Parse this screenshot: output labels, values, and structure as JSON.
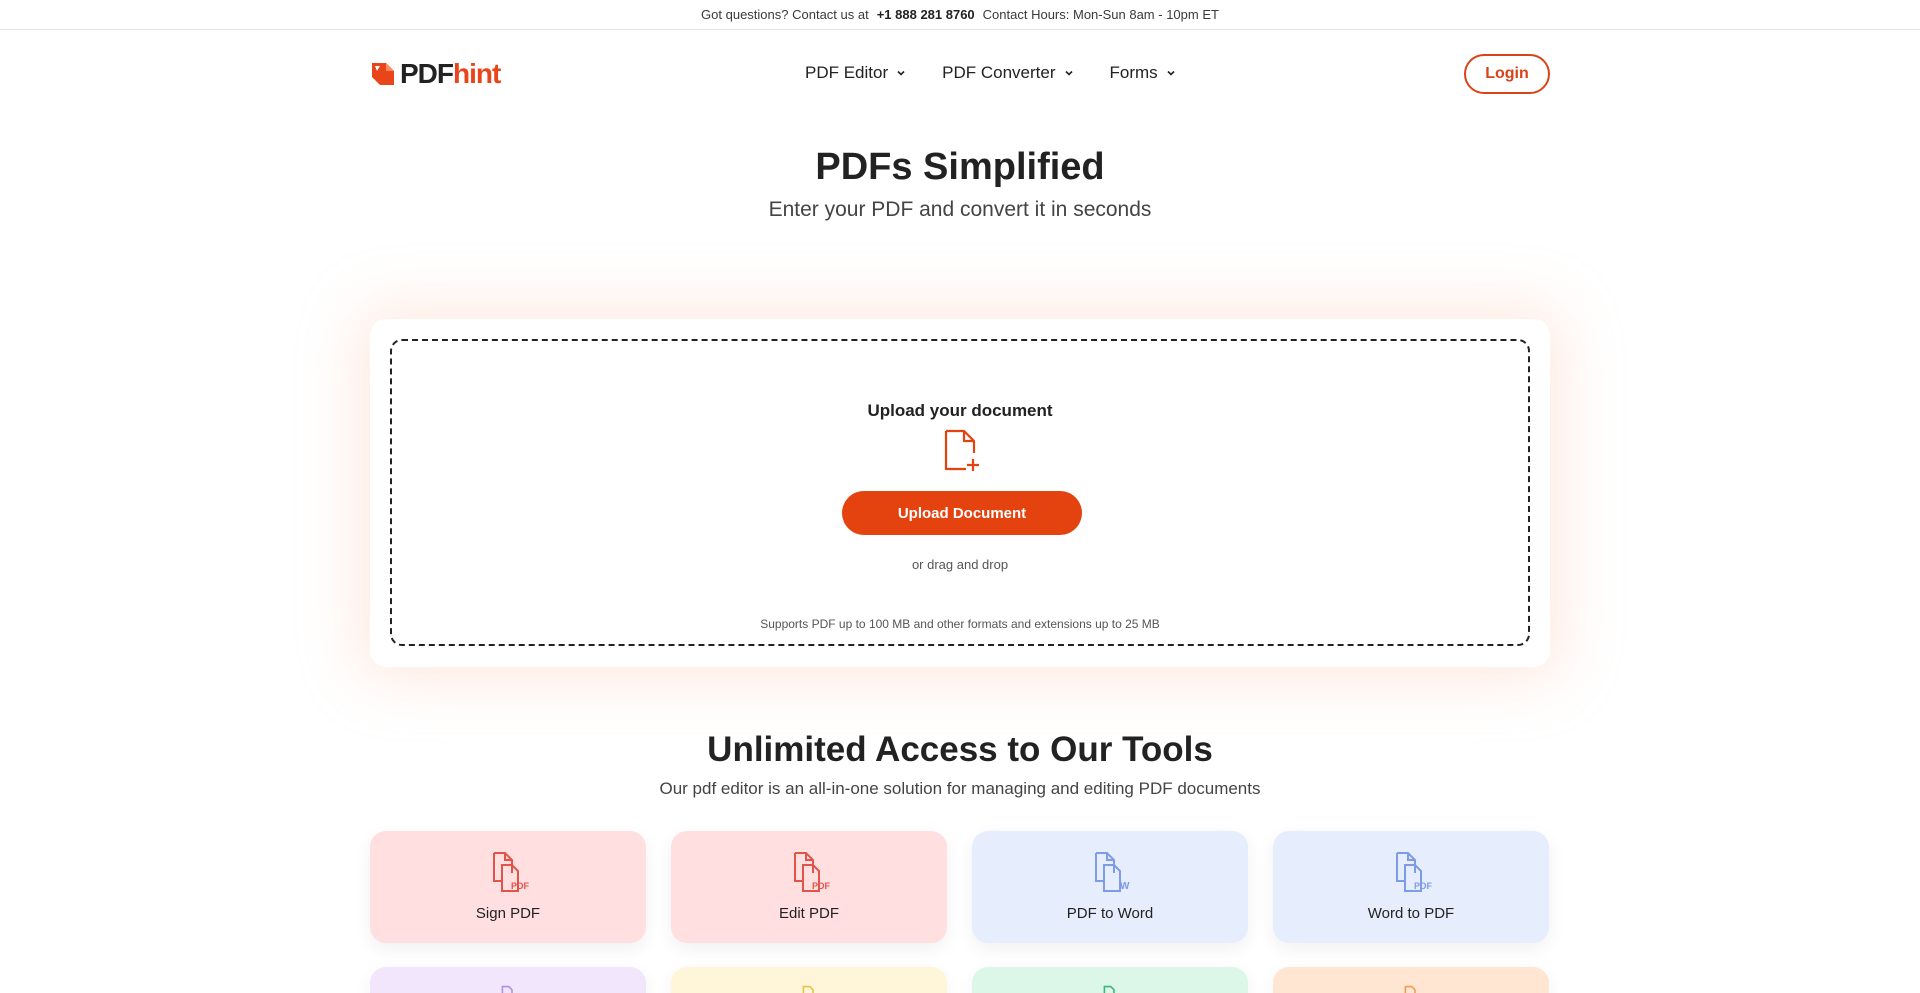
{
  "topbar": {
    "questions": "Got questions? Contact us at",
    "phone": "+1 888 281 8760",
    "hours": "Contact Hours: Mon-Sun 8am - 10pm ET"
  },
  "header": {
    "logo_pdf": "PDF",
    "logo_hint": "hint",
    "nav": [
      {
        "label": "PDF Editor"
      },
      {
        "label": "PDF Converter"
      },
      {
        "label": "Forms"
      }
    ],
    "login_label": "Login"
  },
  "hero": {
    "title": "PDFs Simplified",
    "subtitle": "Enter your PDF and convert it in seconds"
  },
  "upload": {
    "title": "Upload your document",
    "button_label": "Upload Document",
    "or_text": "or drag and drop",
    "supports_text": "Supports PDF up to 100 MB and other formats and extensions up to 25 MB",
    "icon": "file-plus-icon"
  },
  "tools": {
    "title": "Unlimited Access to Our Tools",
    "subtitle": "Our pdf editor is an all-in-one solution for managing and editing PDF documents",
    "items": [
      {
        "label": "Sign PDF",
        "badge": "PDF",
        "bg": "#ffdfe0",
        "color": "#e2534a"
      },
      {
        "label": "Edit PDF",
        "badge": "PDF",
        "bg": "#ffdfe0",
        "color": "#e2534a"
      },
      {
        "label": "PDF to Word",
        "badge": "W",
        "bg": "#e6edfc",
        "color": "#7d9be6"
      },
      {
        "label": "Word to PDF",
        "badge": "PDF",
        "bg": "#e6edfc",
        "color": "#7d9be6"
      }
    ],
    "row2_colors": [
      {
        "bg": "#f1e6fb",
        "color": "#b48fe0"
      },
      {
        "bg": "#fff6d9",
        "color": "#e7c14a"
      },
      {
        "bg": "#dcf7e8",
        "color": "#3cb57a"
      },
      {
        "bg": "#ffe6d2",
        "color": "#ef9e52"
      }
    ]
  },
  "colors": {
    "accent": "#e4420e",
    "text": "#222222"
  }
}
